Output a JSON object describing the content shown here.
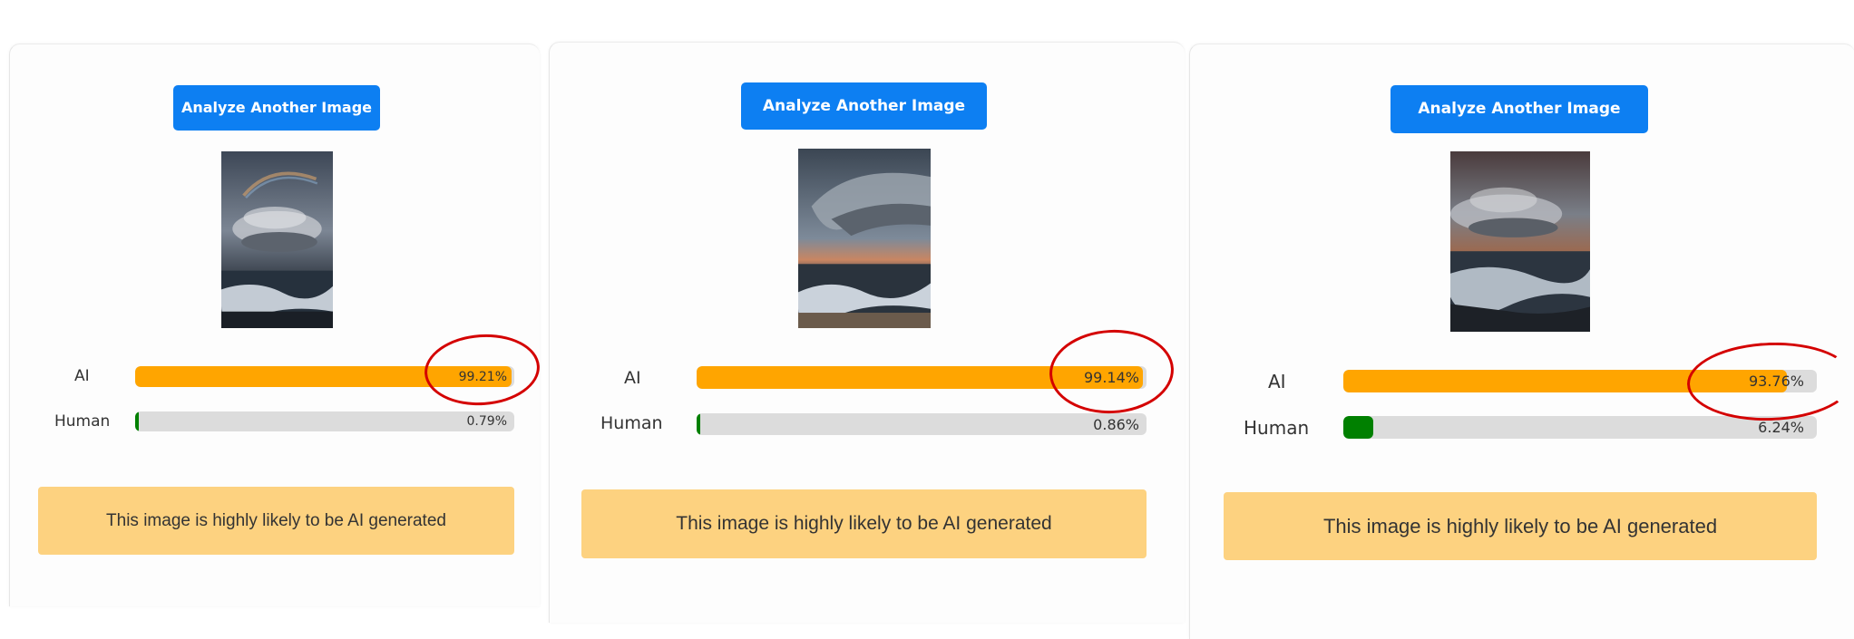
{
  "colors": {
    "button": "#0d7ff2",
    "ai_bar": "#ffa500",
    "human_bar": "#008000",
    "track": "#dcdcdc",
    "verdict_bg": "#fdd280",
    "highlight_circle": "#d40000"
  },
  "results": [
    {
      "button_label": "Analyze Another Image",
      "ai_label": "AI",
      "ai_value": 99.21,
      "ai_text": "99.21%",
      "human_label": "Human",
      "human_value": 0.79,
      "human_text": "0.79%",
      "verdict": "This image is highly likely to be AI generated",
      "highlight_icon": "red-circle"
    },
    {
      "button_label": "Analyze Another Image",
      "ai_label": "AI",
      "ai_value": 99.14,
      "ai_text": "99.14%",
      "human_label": "Human",
      "human_value": 0.86,
      "human_text": "0.86%",
      "verdict": "This image is highly likely to be AI generated",
      "highlight_icon": "red-circle"
    },
    {
      "button_label": "Analyze Another Image",
      "ai_label": "AI",
      "ai_value": 93.76,
      "ai_text": "93.76%",
      "human_label": "Human",
      "human_value": 6.24,
      "human_text": "6.24%",
      "verdict": "This image is highly likely to be AI generated",
      "highlight_icon": "red-circle"
    }
  ]
}
